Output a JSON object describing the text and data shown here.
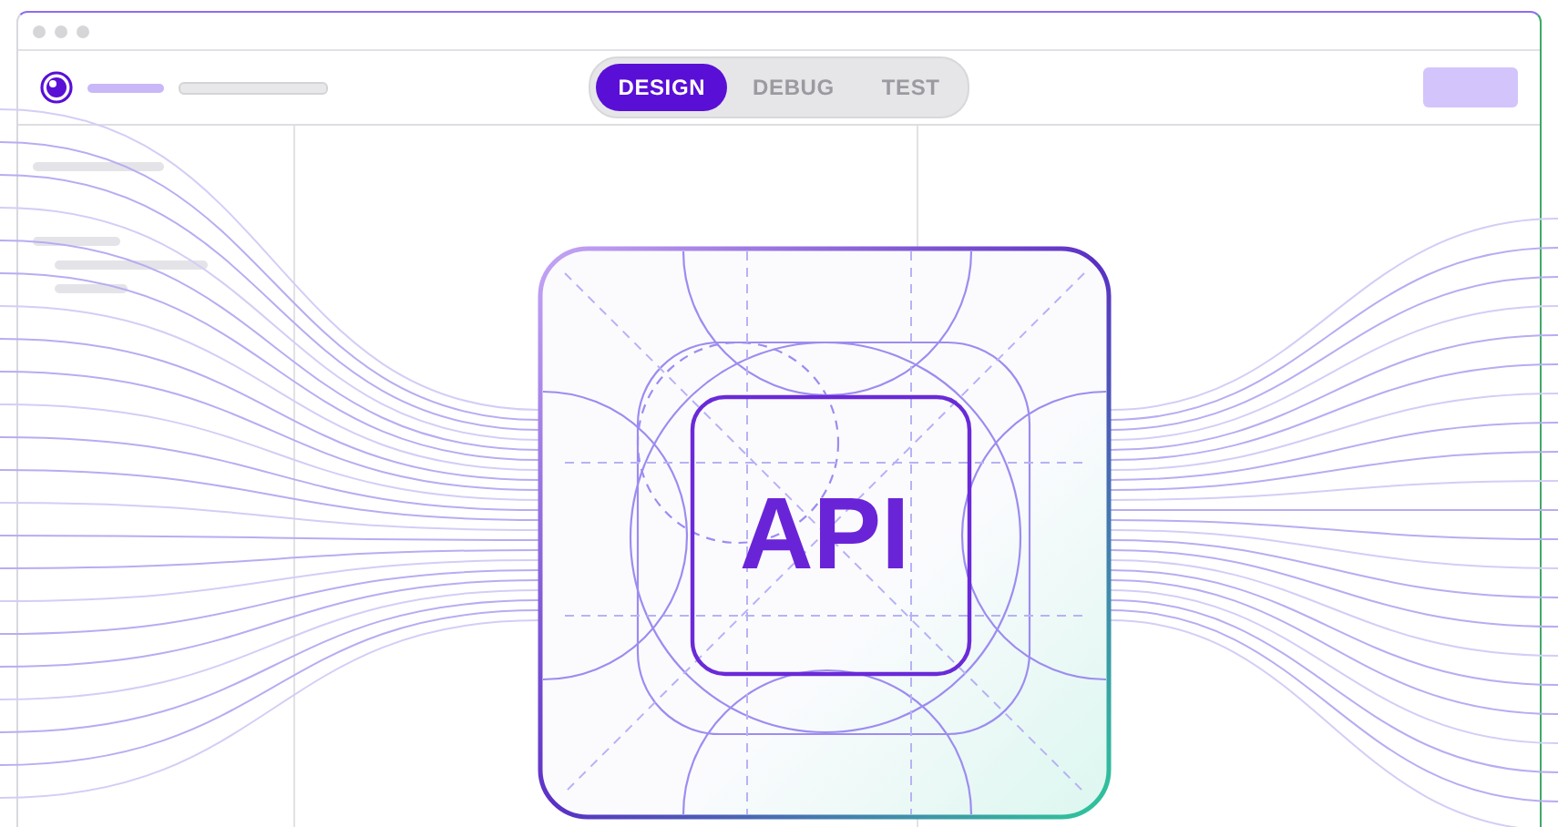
{
  "tabs": [
    {
      "label": "DESIGN",
      "selected": true
    },
    {
      "label": "DEBUG",
      "selected": false
    },
    {
      "label": "TEST",
      "selected": false
    }
  ],
  "tile": {
    "label": "API"
  }
}
